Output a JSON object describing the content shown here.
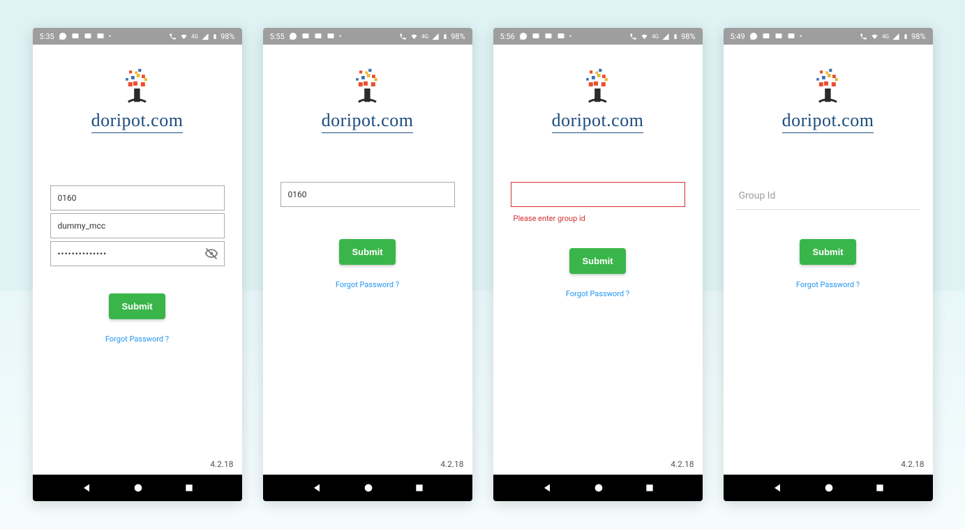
{
  "brand": "doripot.com",
  "version": "4.2.18",
  "status": {
    "battery": "98%"
  },
  "common": {
    "submit": "Submit",
    "forgot": "Forgot Password ?"
  },
  "screens": [
    {
      "time": "5:35",
      "fields": {
        "group_id": "0160",
        "username": "dummy_mcc",
        "password": "••••••••••••••"
      }
    },
    {
      "time": "5:55",
      "fields": {
        "group_id": "0160"
      }
    },
    {
      "time": "5:56",
      "fields": {
        "group_id": "",
        "error": "Please enter group id"
      }
    },
    {
      "time": "5:49",
      "fields": {
        "placeholder": "Group Id"
      }
    }
  ]
}
